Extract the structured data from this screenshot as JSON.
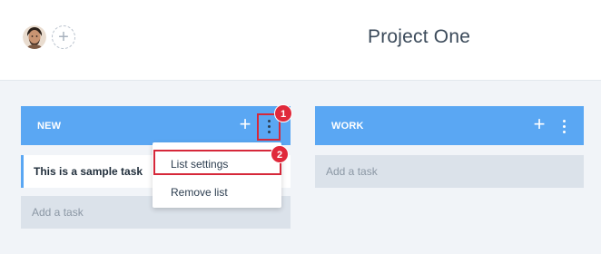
{
  "header": {
    "project_title": "Project One",
    "add_member_symbol": "+"
  },
  "lists": [
    {
      "title": "NEW",
      "add_symbol": "+",
      "tasks": [
        "This is a sample task"
      ],
      "add_task_placeholder": "Add a task"
    },
    {
      "title": "WORK",
      "add_symbol": "+",
      "tasks": [],
      "add_task_placeholder": "Add a task"
    }
  ],
  "menu": {
    "items": [
      "List settings",
      "Remove list"
    ]
  },
  "annotations": {
    "step1": "1",
    "step2": "2"
  },
  "colors": {
    "list_header": "#5aa7f3",
    "highlight": "#d6283a",
    "badge": "#e0293b"
  }
}
